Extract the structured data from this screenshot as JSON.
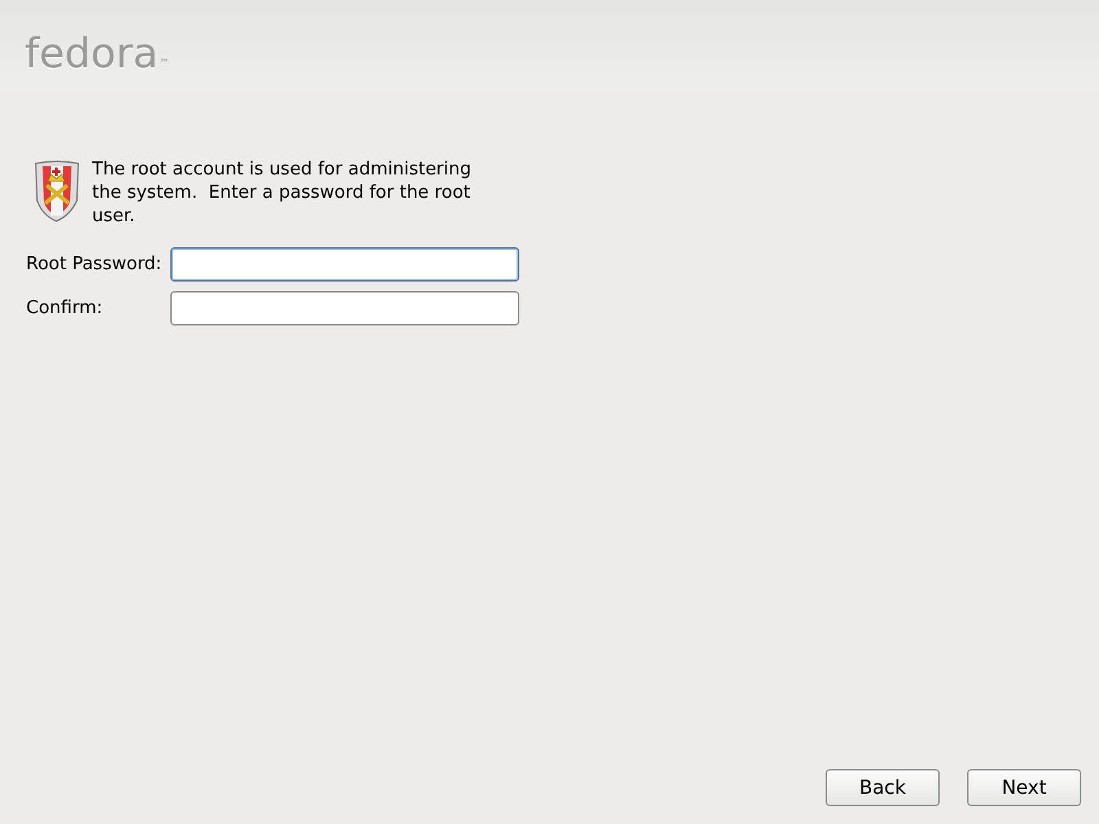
{
  "header": {
    "logo": "fedora",
    "trademark": "™"
  },
  "intro": "The root account is used for administering the system.  Enter a password for the root user.",
  "fields": [
    {
      "label": "Root Password:",
      "focused": true
    },
    {
      "label": "Confirm:",
      "focused": false
    }
  ],
  "buttons": [
    {
      "label": "Back"
    },
    {
      "label": "Next"
    }
  ]
}
